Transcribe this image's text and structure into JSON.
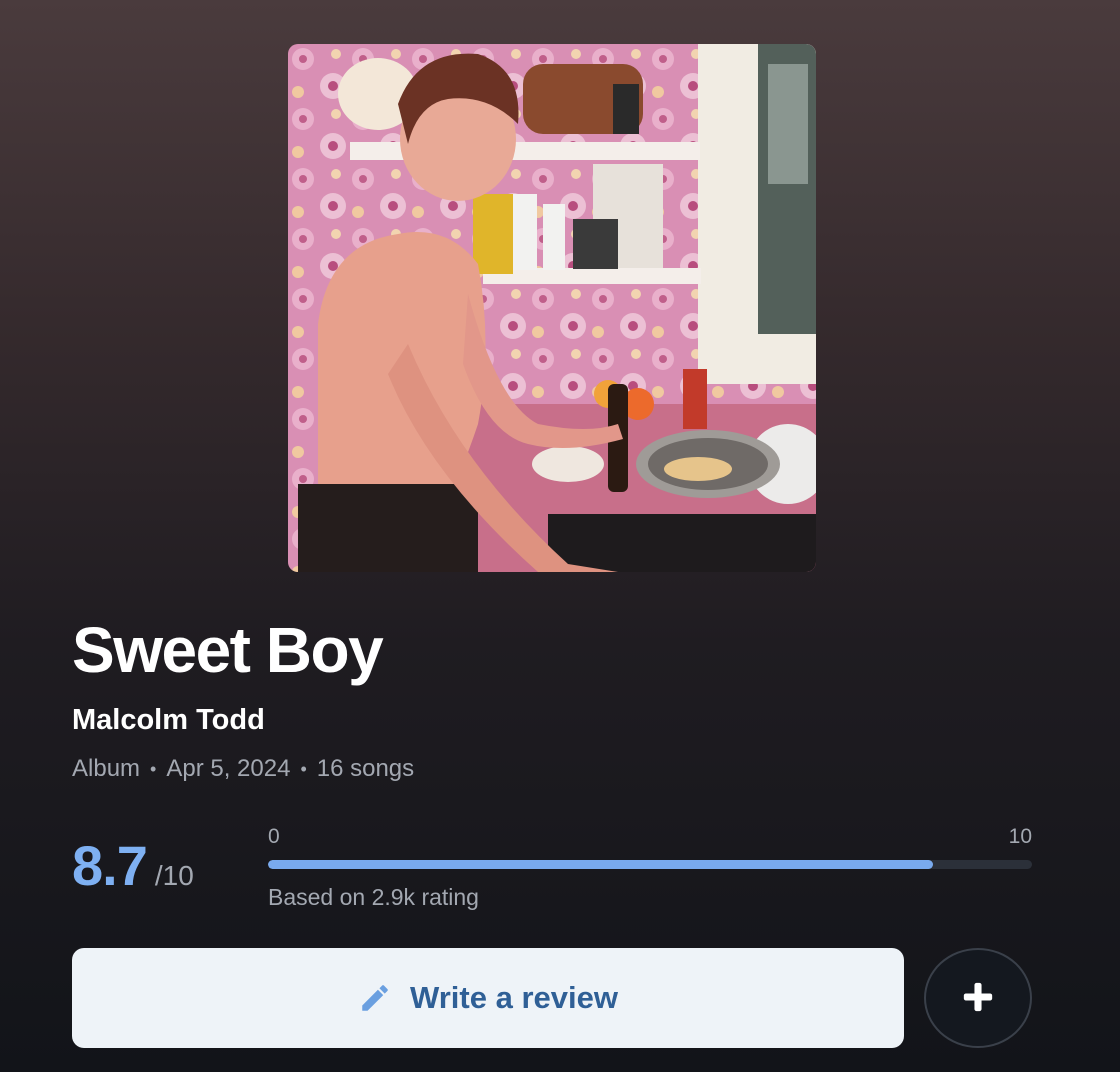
{
  "album": {
    "cover_icon": "album-cover-image",
    "title": "Sweet Boy",
    "artist": "Malcolm Todd",
    "type": "Album",
    "release_date": "Apr 5, 2024",
    "song_count": "16 songs",
    "separator": "•"
  },
  "rating": {
    "score": "8.7",
    "max_label": "/10",
    "scale_min": "0",
    "scale_max": "10",
    "fraction": 0.87,
    "count_text": "Based on 2.9k rating",
    "accent_color": "#7eb0f2"
  },
  "actions": {
    "review_label": "Write a review",
    "review_icon": "pencil-icon",
    "add_icon": "plus-icon"
  }
}
